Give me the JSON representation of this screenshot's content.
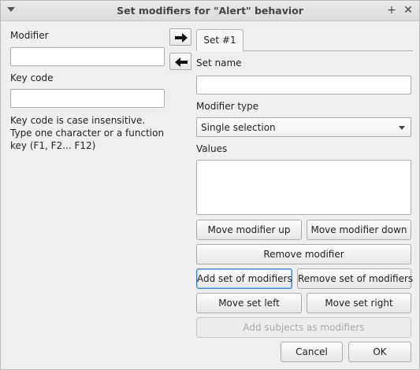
{
  "window": {
    "title": "Set modifiers for \"Alert\" behavior"
  },
  "left": {
    "modifier_label": "Modifier",
    "modifier_value": "",
    "keycode_label": "Key code",
    "keycode_value": "",
    "hint": "Key code is case insensitive. Type one character or a function key (F1, F2... F12)"
  },
  "tabs": [
    {
      "label": "Set #1",
      "selected": true
    }
  ],
  "set": {
    "name_label": "Set name",
    "name_value": "",
    "type_label": "Modifier type",
    "type_value": "Single selection",
    "values_label": "Values",
    "values": []
  },
  "buttons": {
    "move_up": "Move modifier up",
    "move_down": "Move modifier down",
    "remove_modifier": "Remove modifier",
    "add_set": "Add set of modifiers",
    "remove_set": "Remove set of modifiers",
    "move_left": "Move set left",
    "move_right": "Move set right",
    "add_subjects": "Add subjects as modifiers",
    "cancel": "Cancel",
    "ok": "OK"
  },
  "icons": {
    "menu": "chevron-down-icon",
    "pin": "pin-icon",
    "close": "close-icon",
    "add_arrow": "arrow-right-icon",
    "remove_arrow": "arrow-left-icon"
  }
}
